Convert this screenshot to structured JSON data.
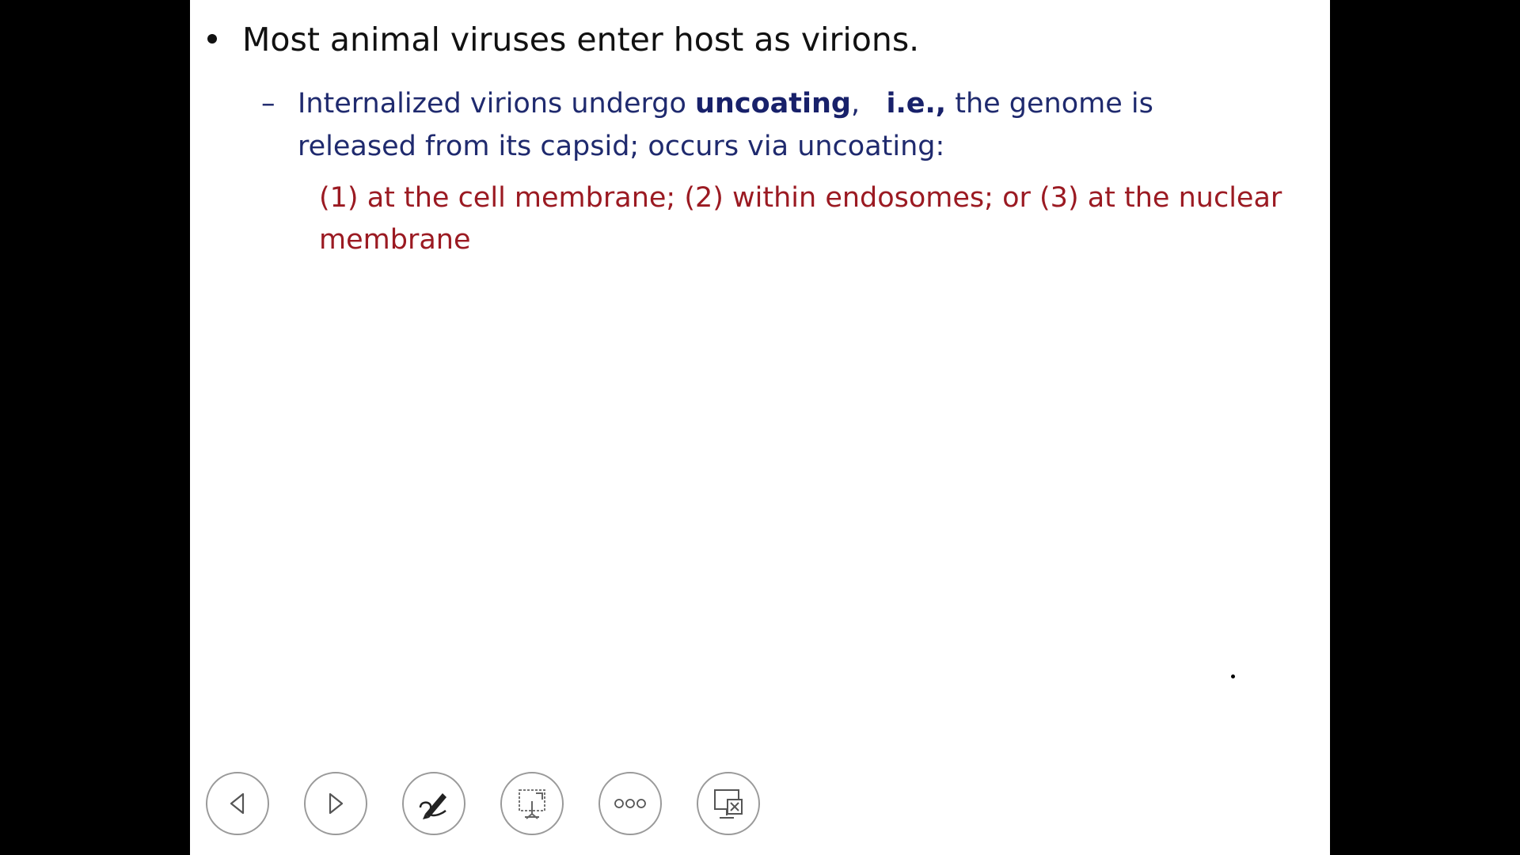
{
  "slide": {
    "bullet_text": "Most animal viruses enter host as virions.",
    "sub_dash": "–",
    "sub_part1": "Internalized virions undergo ",
    "sub_bold1": "uncoating",
    "sub_part2": ",   ",
    "sub_bold2": "i.e.,",
    "sub_part3": " the genome is released from its capsid; occurs via uncoating:",
    "list_text": "(1) at the cell membrane; (2) within endosomes; or (3) at the nuclear membrane"
  },
  "colors": {
    "background": "#000000",
    "slide": "#ffffff",
    "bullet_text": "#111111",
    "sub_text": "#1f2a6e",
    "list_text": "#9b1a22",
    "control_border": "#9a9a9a"
  },
  "controls": [
    {
      "icon": "previous-arrow-icon"
    },
    {
      "icon": "next-arrow-icon"
    },
    {
      "icon": "pen-icon"
    },
    {
      "icon": "slide-zoom-icon"
    },
    {
      "icon": "more-options-icon"
    },
    {
      "icon": "end-show-icon"
    }
  ]
}
